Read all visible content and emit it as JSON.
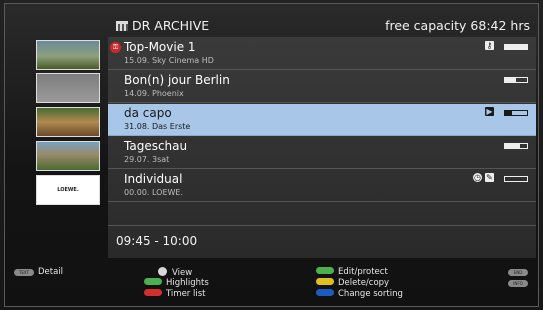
{
  "header": {
    "title": "DR ARCHIVE",
    "capacity": "free capacity 68:42 hrs"
  },
  "recordings": [
    {
      "name": "Top-Movie 1",
      "meta": "15.09.  Sky Cinema HD",
      "progress": 1.0,
      "icons": [
        "key-icon"
      ],
      "badge": "rec-key"
    },
    {
      "name": "Bon(n) jour Berlin",
      "meta": "14.09.  Phoenix",
      "progress": 0.5,
      "icons": []
    },
    {
      "name": "da capo",
      "meta": "31.08.  Das Erste",
      "progress": 0.3,
      "icons": [
        "play-icon"
      ]
    },
    {
      "name": "Tageschau",
      "meta": "29.07.  3sat",
      "progress": 0.7,
      "icons": []
    },
    {
      "name": "Individual",
      "meta": "00.00.  LOEWE.",
      "progress": 0.0,
      "icons": [
        "timer-icon",
        "edit-icon"
      ]
    }
  ],
  "thumb5_label": "LOEWE.",
  "time_range": "09:45 - 10:00",
  "footer": {
    "text_key": "TEXT",
    "detail": "Detail",
    "view": "View",
    "highlights": "Highlights",
    "timer_list": "Timer list",
    "edit_protect": "Edit/protect",
    "delete_copy": "Delete/copy",
    "change_sorting": "Change sorting",
    "end_key": "END",
    "info_key": "INFO"
  },
  "colors": {
    "selected_row": "#a8c6e8",
    "green_key": "#4caf50",
    "red_key": "#d32f2f",
    "yellow_key": "#e0c020",
    "blue_key": "#1e5bbf"
  }
}
